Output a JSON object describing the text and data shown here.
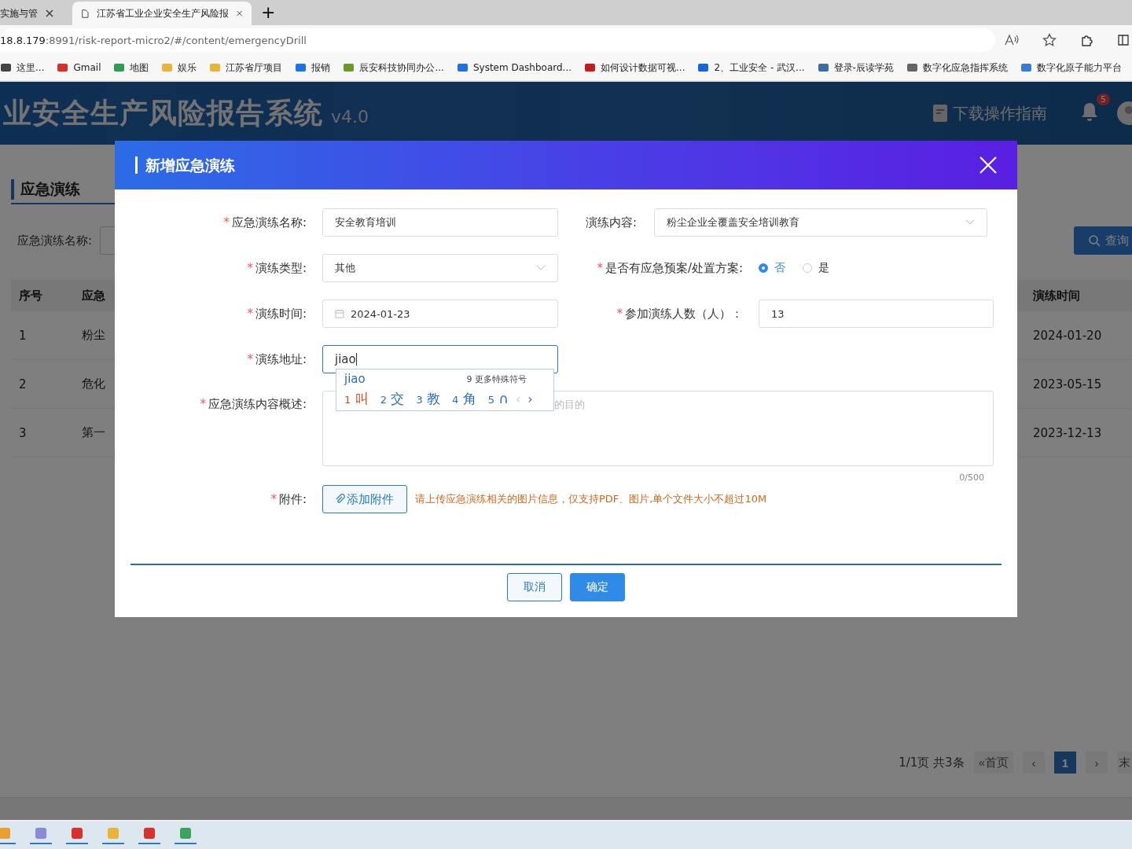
{
  "browser": {
    "tabs": [
      {
        "title": "实施与管",
        "selected": false
      },
      {
        "title": "江苏省工业企业安全生产风险报",
        "selected": true
      }
    ],
    "new_tab": "+",
    "address": {
      "host": "18.8.179",
      "path": ":8991/risk-report-micro2/#/content/emergencyDrill"
    },
    "bookmarks": [
      {
        "label": "这里..."
      },
      {
        "label": "Gmail"
      },
      {
        "label": "地图"
      },
      {
        "label": "娱乐"
      },
      {
        "label": "江苏省厅项目"
      },
      {
        "label": "报销"
      },
      {
        "label": "辰安科技协同办公..."
      },
      {
        "label": "System Dashboard..."
      },
      {
        "label": "如何设计数据可视..."
      },
      {
        "label": "2、工业安全 - 武汉..."
      },
      {
        "label": "登录-辰读学苑"
      },
      {
        "label": "数字化应急指挥系统"
      },
      {
        "label": "数字化原子能力平台"
      }
    ]
  },
  "header": {
    "title": "业安全生产风险报告系统",
    "version": "v4.0",
    "guide": "下载操作指南",
    "notifications": "5"
  },
  "page": {
    "title": "应急演练",
    "search_label": "应急演练名称:",
    "query_button": "查询",
    "columns": [
      "序号",
      "应急",
      "演练时间"
    ],
    "rows": [
      {
        "no": "1",
        "name": "粉尘",
        "time": "2024-01-20"
      },
      {
        "no": "2",
        "name": "危化",
        "time": "2023-05-15"
      },
      {
        "no": "3",
        "name": "第一",
        "time": "2023-12-13"
      }
    ],
    "pagination": {
      "summary": "1/1页 共3条",
      "first": "«首页",
      "prev": "‹",
      "pages": [
        {
          "label": "1",
          "selected": true
        }
      ],
      "next": "›",
      "last": "末"
    }
  },
  "modal": {
    "title": "新增应急演练",
    "rows": [
      {
        "fields": [
          {
            "kind": "text",
            "required_mark": "*",
            "label": "应急演练名称:",
            "value": "安全教育培训",
            "focused": false
          },
          {
            "kind": "select",
            "label": "演练内容:",
            "value": "粉尘企业全覆盖安全培训教育"
          }
        ]
      },
      {
        "fields": [
          {
            "kind": "select",
            "required_mark": "*",
            "label": "演练类型:",
            "value": "其他"
          },
          {
            "kind": "radio",
            "required_mark": "*",
            "label": "是否有应急预案/处置方案:",
            "options": [
              {
                "label": "否",
                "selected": true
              },
              {
                "label": "是",
                "selected": false
              }
            ]
          }
        ]
      },
      {
        "fields": [
          {
            "kind": "date",
            "required_mark": "*",
            "label": "演练时间:",
            "value": "2024-01-23"
          },
          {
            "kind": "text",
            "required_mark": "*",
            "label": "参加演练人数（人）：",
            "value": "13",
            "focused": false
          }
        ]
      },
      {
        "fields": [
          {
            "kind": "text",
            "required_mark": "*",
            "label": "演练地址:",
            "value": "jiao",
            "focused": true
          }
        ]
      }
    ],
    "summary": {
      "required_mark": "*",
      "label": "应急演练内容概述:",
      "placeholder": "的目的",
      "counter": "0/500"
    },
    "attachment": {
      "required_mark": "*",
      "label": "附件:",
      "button": "添加附件",
      "hint": "请上传应急演练相关的图片信息，仅支持PDF、图片,单个文件大小不超过10M"
    },
    "cancel": "取消",
    "confirm": "确定"
  },
  "ime": {
    "composition": "jiao",
    "more_number": "9",
    "more": "更多特殊符号",
    "candidates": [
      {
        "number": "1",
        "text": "叫",
        "selected": true
      },
      {
        "number": "2",
        "text": "交",
        "selected": false
      },
      {
        "number": "3",
        "text": "教",
        "selected": false
      },
      {
        "number": "4",
        "text": "角",
        "selected": false
      },
      {
        "number": "5",
        "text": "∩",
        "selected": false
      }
    ],
    "prev": "‹",
    "next": "›"
  }
}
